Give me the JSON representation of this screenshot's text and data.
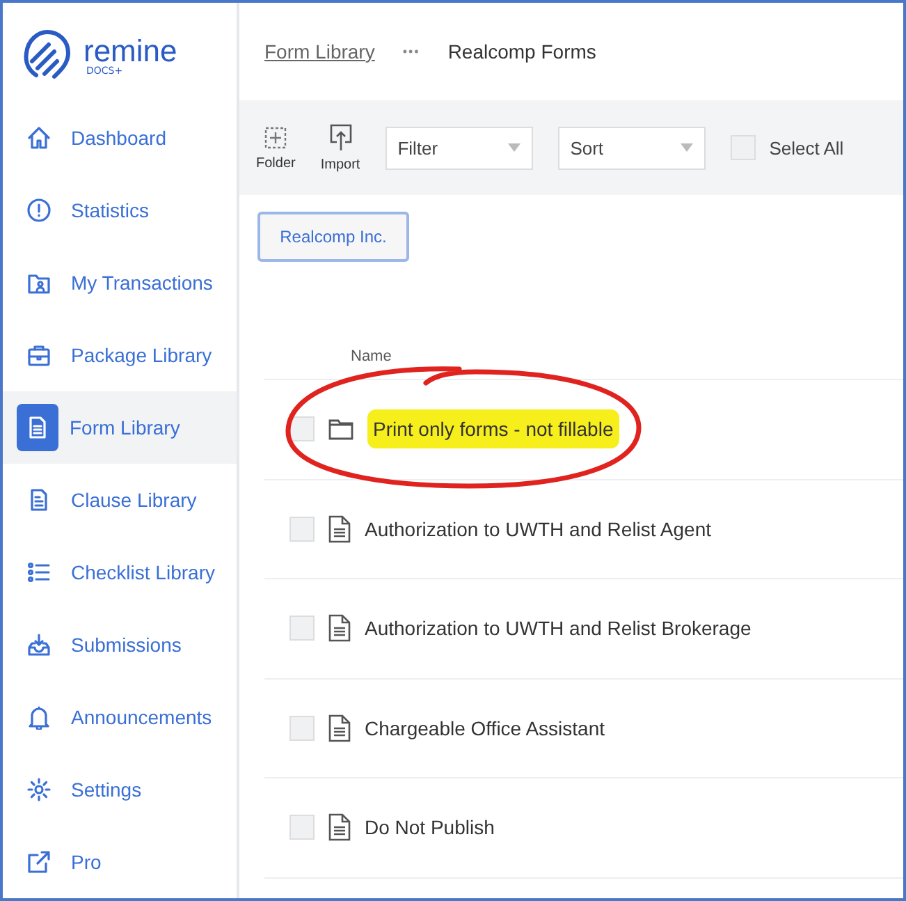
{
  "logo": {
    "name": "remine",
    "sub": "DOCS+"
  },
  "nav": [
    {
      "label": "Dashboard",
      "selected": false
    },
    {
      "label": "Statistics",
      "selected": false
    },
    {
      "label": "My Transactions",
      "selected": false
    },
    {
      "label": "Package Library",
      "selected": false
    },
    {
      "label": "Form Library",
      "selected": true
    },
    {
      "label": "Clause Library",
      "selected": false
    },
    {
      "label": "Checklist Library",
      "selected": false
    },
    {
      "label": "Submissions",
      "selected": false
    },
    {
      "label": "Announcements",
      "selected": false
    },
    {
      "label": "Settings",
      "selected": false
    },
    {
      "label": "Pro",
      "selected": false
    }
  ],
  "breadcrumb": {
    "link": "Form Library",
    "more": "•••",
    "current": "Realcomp Forms"
  },
  "toolbar": {
    "folder": "Folder",
    "import": "Import",
    "filter": {
      "placeholder": "Filter"
    },
    "sort": {
      "placeholder": "Sort"
    },
    "select_all": {
      "label": "Select All",
      "checked": false
    }
  },
  "group_button": "Realcomp Inc.",
  "table": {
    "columns": [
      "Name"
    ],
    "rows": [
      {
        "kind": "folder",
        "name": "Print only forms - not fillable",
        "checked": false,
        "highlighted": true,
        "circled": true
      },
      {
        "kind": "document",
        "name": "Authorization to UWTH and Relist Agent",
        "checked": false,
        "highlighted": false,
        "circled": false
      },
      {
        "kind": "document",
        "name": "Authorization to UWTH and Relist Brokerage",
        "checked": false,
        "highlighted": false,
        "circled": false
      },
      {
        "kind": "document",
        "name": "Chargeable Office Assistant",
        "checked": false,
        "highlighted": false,
        "circled": false
      },
      {
        "kind": "document",
        "name": "Do Not Publish",
        "checked": false,
        "highlighted": false,
        "circled": false
      }
    ]
  }
}
